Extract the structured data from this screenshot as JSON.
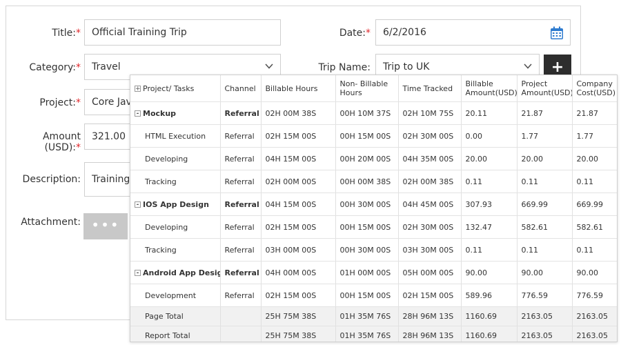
{
  "form": {
    "title_label": "Title:",
    "title_value": "Official Training Trip",
    "date_label": "Date:",
    "date_value": "6/2/2016",
    "category_label": "Category:",
    "category_value": "Travel",
    "trip_label": "Trip Name:",
    "trip_value": "Trip to UK",
    "project_label": "Project:",
    "project_value": "Core Jav",
    "amount_label": "Amount (USD):",
    "amount_value": "321.00",
    "description_label": "Description:",
    "description_value": "Training",
    "attachment_label": "Attachment:",
    "required_mark": "*",
    "plus_label": "+",
    "attach_dots": "•••"
  },
  "report": {
    "headers": {
      "task": "Project/ Tasks",
      "channel": "Channel",
      "billable_hours": "Billable Hours",
      "non_billable_hours": "Non- Billable Hours",
      "time_tracked": "Time Tracked",
      "billable_amount": "Billable Amount(USD)",
      "project_amount": "Project Amount(USD)",
      "company_cost": "Company Cost(USD)"
    },
    "expand_all": "+",
    "collapse": "-",
    "rows": [
      {
        "task": "Mockup",
        "channel": "Referral",
        "bh": "02H 00M 38S",
        "nbh": "00H 10M 37S",
        "tt": "02H 10M 75S",
        "ba": "20.11",
        "pa": "21.87",
        "cc": "21.87"
      },
      {
        "task": "HTML Execution",
        "channel": "Referral",
        "bh": "02H 15M 00S",
        "nbh": "00H 15M 00S",
        "tt": "02H 30M 00S",
        "ba": "0.00",
        "pa": "1.77",
        "cc": "1.77"
      },
      {
        "task": "Developing",
        "channel": "Referral",
        "bh": "04H 15M 00S",
        "nbh": "00H 20M 00S",
        "tt": "04H 35M 00S",
        "ba": "20.00",
        "pa": "20.00",
        "cc": "20.00"
      },
      {
        "task": "Tracking",
        "channel": "Referral",
        "bh": "02H 00M 00S",
        "nbh": "00H 00M 38S",
        "tt": "02H 00M 38S",
        "ba": "0.11",
        "pa": "0.11",
        "cc": "0.11"
      },
      {
        "task": "IOS App Design",
        "channel": "Referral",
        "bh": "04H 15M 00S",
        "nbh": "00H 30M 00S",
        "tt": "04H 45M 00S",
        "ba": "307.93",
        "pa": "669.99",
        "cc": "669.99"
      },
      {
        "task": "Developing",
        "channel": "Referral",
        "bh": "02H 15M 00S",
        "nbh": "00H 15M 00S",
        "tt": "02H 30M 00S",
        "ba": "132.47",
        "pa": "582.61",
        "cc": "582.61"
      },
      {
        "task": "Tracking",
        "channel": "Referral",
        "bh": "03H 00M 00S",
        "nbh": "00H 30M 00S",
        "tt": "03H 30M 00S",
        "ba": "0.11",
        "pa": "0.11",
        "cc": "0.11"
      },
      {
        "task": "Android App Design",
        "channel": "Referral",
        "bh": "04H 00M 00S",
        "nbh": "01H 00M 00S",
        "tt": "05H 00M 00S",
        "ba": "90.00",
        "pa": "90.00",
        "cc": "90.00"
      },
      {
        "task": "Development",
        "channel": "Referral",
        "bh": "02H 15M 00S",
        "nbh": "00H 15M 00S",
        "tt": "02H 15M 00S",
        "ba": "589.96",
        "pa": "776.59",
        "cc": "776.59"
      }
    ],
    "page_total": {
      "label": "Page Total",
      "bh": "25H 75M 38S",
      "nbh": "01H 35M 76S",
      "tt": "28H 96M 13S",
      "ba": "1160.69",
      "pa": "2163.05",
      "cc": "2163.05"
    },
    "report_total": {
      "label": "Report Total",
      "bh": "25H 75M 38S",
      "nbh": "01H 35M 76S",
      "tt": "28H 96M 13S",
      "ba": "1160.69",
      "pa": "2163.05",
      "cc": "2163.05"
    }
  },
  "icons": {
    "calendar": "calendar-icon",
    "dropdown": "chevron-down-icon",
    "add": "plus-icon",
    "more": "ellipsis-icon"
  },
  "colors": {
    "required": "#e0262b",
    "calendar_accent": "#2e7bcf",
    "plus_button": "#2d2d2d",
    "attach_button": "#c8c8c8",
    "total_row_bg": "#f1f1f1"
  }
}
